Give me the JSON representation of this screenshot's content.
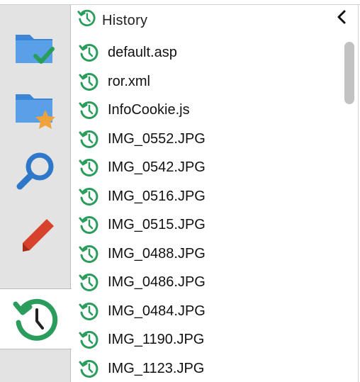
{
  "sidebar": {
    "items": [
      {
        "name": "folder-check-icon"
      },
      {
        "name": "folder-star-icon"
      },
      {
        "name": "search-icon"
      },
      {
        "name": "bookmark-icon"
      },
      {
        "name": "history-icon",
        "active": true
      }
    ]
  },
  "panel": {
    "title": "History",
    "collapse_icon": "chevron-left-icon"
  },
  "history": {
    "items": [
      {
        "label": "default.asp"
      },
      {
        "label": "ror.xml"
      },
      {
        "label": "InfoCookie.js"
      },
      {
        "label": "IMG_0552.JPG"
      },
      {
        "label": "IMG_0542.JPG"
      },
      {
        "label": "IMG_0516.JPG"
      },
      {
        "label": "IMG_0515.JPG"
      },
      {
        "label": "IMG_0488.JPG"
      },
      {
        "label": "IMG_0486.JPG"
      },
      {
        "label": "IMG_0484.JPG"
      },
      {
        "label": "IMG_1190.JPG"
      },
      {
        "label": "IMG_1123.JPG"
      }
    ]
  },
  "colors": {
    "accent_green": "#2a9d5c",
    "folder_blue": "#4a90d9",
    "bookmark_red": "#d6422c",
    "star_orange": "#f0a23a"
  }
}
